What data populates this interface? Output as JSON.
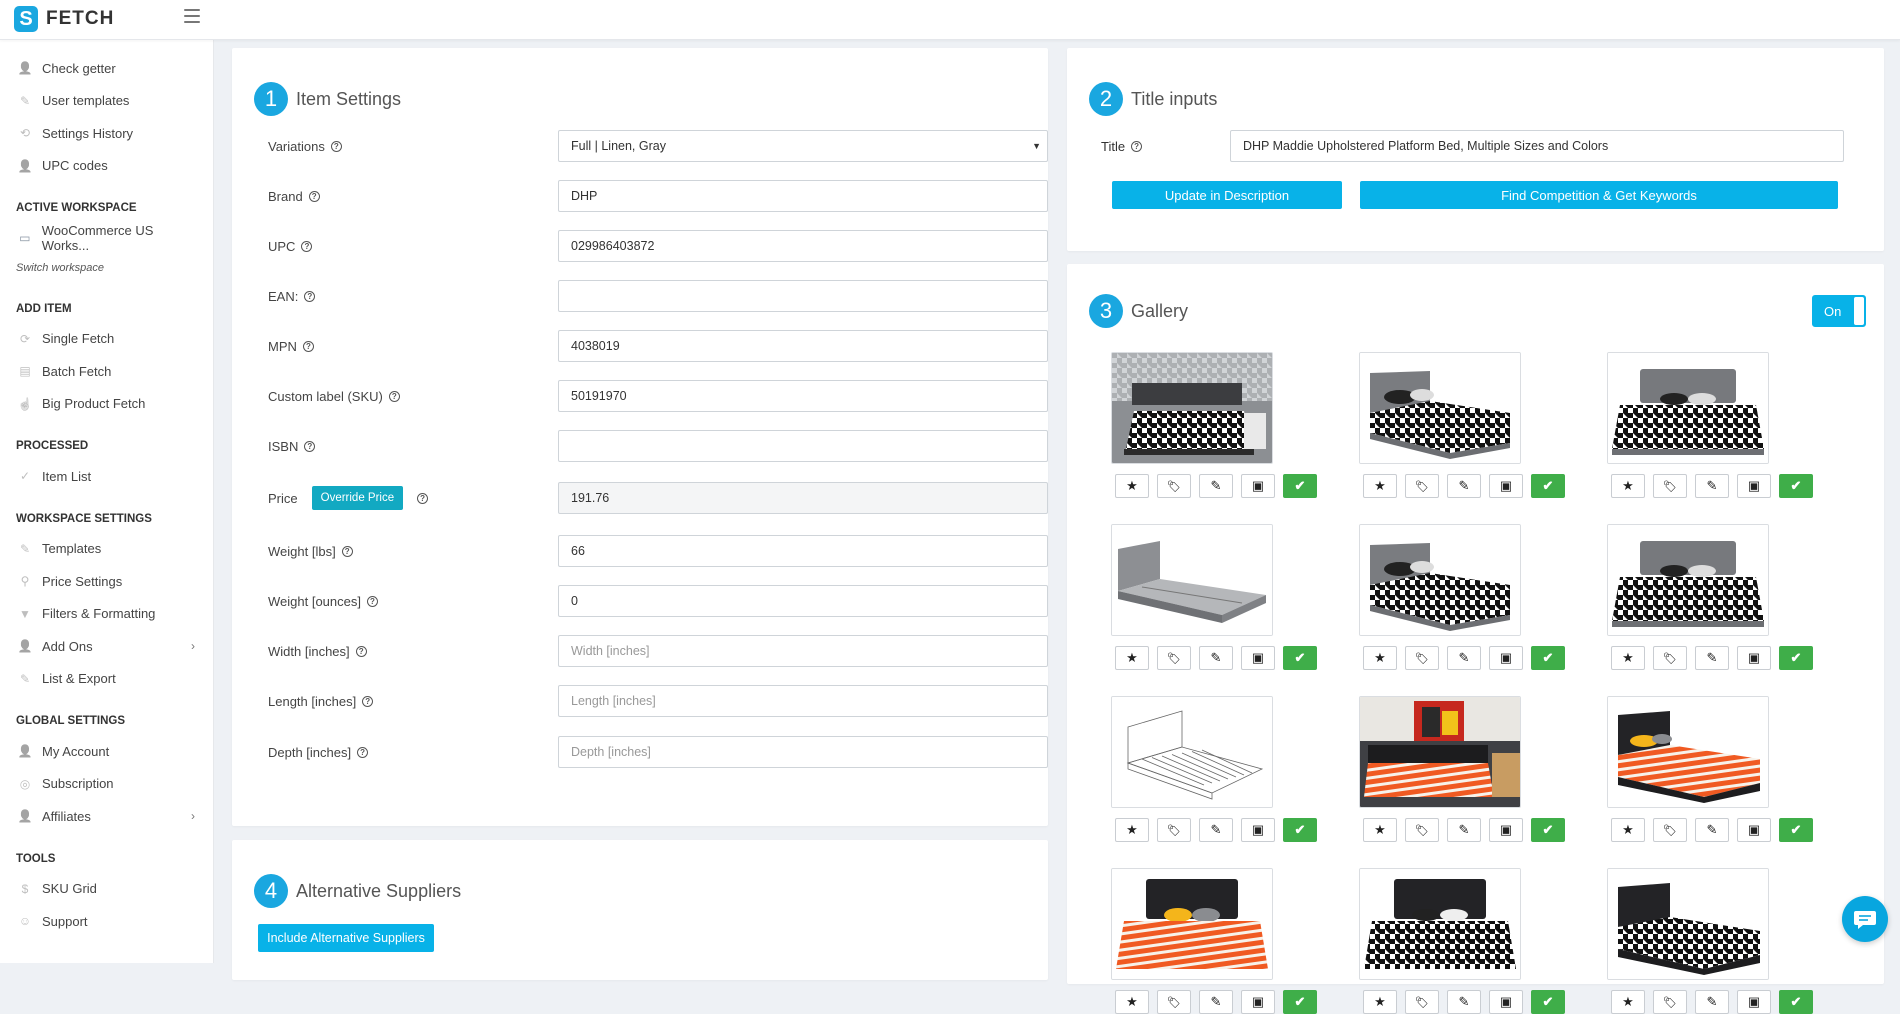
{
  "app": {
    "name": "FETCH"
  },
  "sidebar": {
    "top_items": [
      {
        "label": "Check getter",
        "icon": "users-icon"
      },
      {
        "label": "User templates",
        "icon": "magic-wand-icon"
      },
      {
        "label": "Settings History",
        "icon": "history-icon"
      },
      {
        "label": "UPC codes",
        "icon": "users-icon"
      }
    ],
    "active_workspace": {
      "heading": "ACTIVE WORKSPACE",
      "item": "WooCommerce US Works...",
      "switch": "Switch workspace"
    },
    "add_item": {
      "heading": "ADD ITEM",
      "items": [
        "Single Fetch",
        "Batch Fetch",
        "Big Product Fetch"
      ]
    },
    "processed": {
      "heading": "PROCESSED",
      "items": [
        "Item List"
      ]
    },
    "workspace_settings": {
      "heading": "WORKSPACE SETTINGS",
      "items": [
        "Templates",
        "Price Settings",
        "Filters & Formatting",
        "Add Ons",
        "List & Export"
      ]
    },
    "global_settings": {
      "heading": "GLOBAL SETTINGS",
      "items": [
        "My Account",
        "Subscription",
        "Affiliates"
      ]
    },
    "tools": {
      "heading": "TOOLS",
      "items": [
        "SKU Grid",
        "Support"
      ]
    }
  },
  "item_settings": {
    "number": "1",
    "title": "Item Settings",
    "fields": {
      "variations": {
        "label": "Variations",
        "value": "Full | Linen, Gray"
      },
      "brand": {
        "label": "Brand",
        "value": "DHP"
      },
      "upc": {
        "label": "UPC",
        "value": "029986403872"
      },
      "ean": {
        "label": "EAN:",
        "value": ""
      },
      "mpn": {
        "label": "MPN",
        "value": "4038019"
      },
      "sku": {
        "label": "Custom label (SKU)",
        "value": "50191970"
      },
      "isbn": {
        "label": "ISBN",
        "value": ""
      },
      "price": {
        "label": "Price",
        "override_label": "Override Price",
        "value": "191.76"
      },
      "weight_lbs": {
        "label": "Weight [lbs]",
        "value": "66"
      },
      "weight_oz": {
        "label": "Weight [ounces]",
        "value": "0"
      },
      "width": {
        "label": "Width [inches]",
        "placeholder": "Width [inches]"
      },
      "length": {
        "label": "Length [inches]",
        "placeholder": "Length [inches]"
      },
      "depth": {
        "label": "Depth [inches]",
        "placeholder": "Depth [inches]"
      }
    }
  },
  "title_inputs": {
    "number": "2",
    "title": "Title inputs",
    "field_label": "Title",
    "value": "DHP Maddie Upholstered Platform Bed, Multiple Sizes and Colors",
    "update_btn": "Update in Description",
    "find_btn": "Find Competition & Get Keywords"
  },
  "gallery": {
    "number": "3",
    "title": "Gallery",
    "toggle": "On",
    "images": [
      {
        "kind": "room-houndstooth"
      },
      {
        "kind": "gray-houndstooth"
      },
      {
        "kind": "gray-houndstooth-front"
      },
      {
        "kind": "gray-frame"
      },
      {
        "kind": "gray-houndstooth"
      },
      {
        "kind": "gray-houndstooth-front"
      },
      {
        "kind": "sketch"
      },
      {
        "kind": "room-orange"
      },
      {
        "kind": "black-orange"
      },
      {
        "kind": "black-orange-front"
      },
      {
        "kind": "black-houndstooth-front"
      },
      {
        "kind": "black-houndstooth"
      }
    ]
  },
  "alt_suppliers": {
    "number": "4",
    "title": "Alternative Suppliers",
    "button": "Include Alternative Suppliers"
  }
}
